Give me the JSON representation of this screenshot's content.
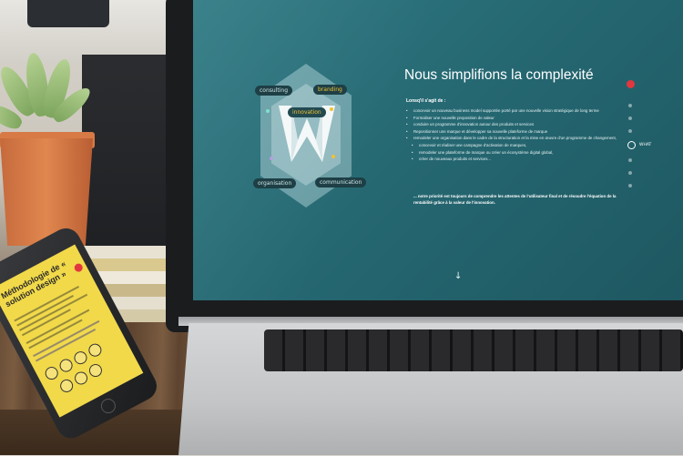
{
  "screen": {
    "title": "Nous simplifions la complexité",
    "lead": "Lonsq'il s'agit de :",
    "bullets": [
      "concevoir un nouveau business model supportée porté par une nouvelle vision stratégique de long terme",
      "Formaliser une nouvelle proposition de valeur",
      "conduire un programme d'innovation autour des produits et services",
      "Repositionner une marque et développer sa nouvelle plateforme de marque",
      "remodeler une organisation dans le cadre de la structuration et la mise en œuvre d'un programme de changement,",
      "concevoir et réaliser une campagne d'activation de marques,",
      "remodeler une plateforme de marque ou créer un écosystème digital global,",
      "créer de nouveaux produits et services..."
    ],
    "conclusion": "... notre priorité est toujours de comprendre les attentes de l'utilisateur final et de résoudre l'équation de la rentabilité grâce à la valeur de l'innovation.",
    "diagram_tags": {
      "consulting": "consulting",
      "branding": "branding",
      "innovation": "innovation",
      "organisation": "organisation",
      "communication": "communication"
    },
    "nav_current_label": "WHAT",
    "scroll_icon": "arrow-down-icon",
    "colors": {
      "screen_bg": "#24656f",
      "accent_red": "#e3363f",
      "accent_yellow": "#f2c230"
    }
  },
  "phone": {
    "title": "Méthodologie de « solution design »",
    "badge_icon": "close-icon",
    "screen_color": "#f1d94a"
  }
}
